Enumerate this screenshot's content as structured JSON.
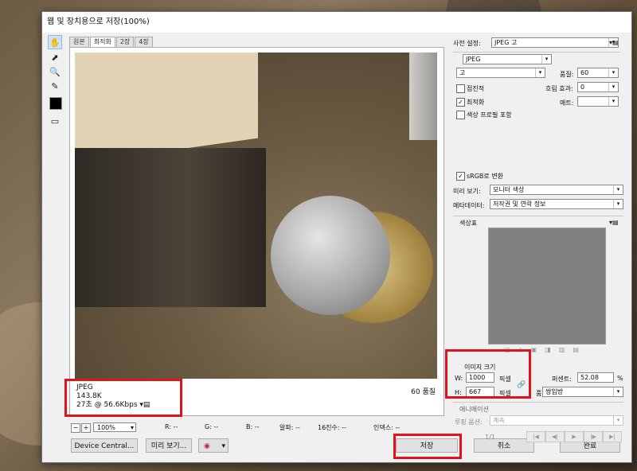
{
  "window": {
    "title": "웹 및 장치용으로 저장(100%)"
  },
  "tabs": [
    "원본",
    "최적화",
    "2장",
    "4장"
  ],
  "preview_info": {
    "format": "JPEG",
    "size": "143.8K",
    "time": "27초 @ 56.6Kbps",
    "quality": "60 품질"
  },
  "statusbar": {
    "zoom": "100%",
    "r": "R: --",
    "g": "G: --",
    "b": "B: --",
    "alpha": "알파: --",
    "hex": "16진수: --",
    "index": "인덱스: --"
  },
  "buttons": {
    "device_central": "Device Central...",
    "preview": "미리 보기...",
    "save": "저장",
    "cancel": "취소",
    "done": "완료"
  },
  "settings": {
    "preset_label": "사전 설정:",
    "preset_value": "JPEG 고",
    "format_value": "JPEG",
    "quality_level": "고",
    "quality_label": "품질:",
    "quality_value": "60",
    "progressive_label": "점진적",
    "blur_label": "흐림 효과:",
    "blur_value": "0",
    "optimized_label": "최적화",
    "matte_label": "매트:",
    "embed_profile_label": "색상 프로필 포함",
    "srgb_label": "sRGB로 변환",
    "preview_label": "미리 보기:",
    "preview_value": "모니터 색상",
    "metadata_label": "메타데이터:",
    "metadata_value": "저작권 및 연락 정보",
    "color_table_label": "색상표"
  },
  "image_size": {
    "title": "이미지 크기",
    "w_label": "W:",
    "w_value": "1000",
    "h_label": "H:",
    "h_value": "667",
    "unit": "픽셀",
    "percent_label": "퍼센트:",
    "percent_value": "52.08",
    "percent_unit": "%",
    "quality_label": "품질:",
    "quality_value": "쌍입방"
  },
  "animation": {
    "title": "애니메이션",
    "loop_label": "루핑 옵션:",
    "loop_value": "계속",
    "frame": "1/1"
  },
  "colors": {
    "accent_red": "#e0141e",
    "dialog_bg": "#f0f0f0"
  }
}
